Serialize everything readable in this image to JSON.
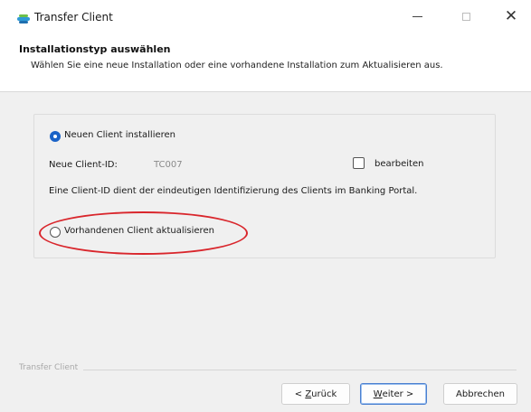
{
  "window": {
    "title": "Transfer Client",
    "controls": {
      "minimize_icon": "minimize-icon",
      "maximize_icon": "maximize-icon",
      "close_glyph": "✕"
    }
  },
  "header": {
    "title": "Installationstyp auswählen",
    "description": "Wählen Sie eine neue Installation oder eine vorhandene Installation zum Aktualisieren aus."
  },
  "options": {
    "new_client": {
      "label": "Neuen Client installieren",
      "selected": true
    },
    "client_id": {
      "label": "Neue Client-ID:",
      "value": "TC007"
    },
    "edit_checkbox": {
      "label": "bearbeiten",
      "checked": false
    },
    "info": "Eine Client-ID dient der eindeutigen Identifizierung des Clients im Banking Portal.",
    "existing_client": {
      "label": "Vorhandenen Client aktualisieren",
      "selected": false
    }
  },
  "footer": {
    "brand": "Transfer Client",
    "buttons": {
      "back": {
        "prefix": "< ",
        "mnemonic": "Z",
        "rest": "urück"
      },
      "next": {
        "mnemonic": "W",
        "rest": "eiter >"
      },
      "cancel": "Abbrechen"
    }
  },
  "colors": {
    "accent": "#1a63c7",
    "highlight": "#d9262c"
  }
}
